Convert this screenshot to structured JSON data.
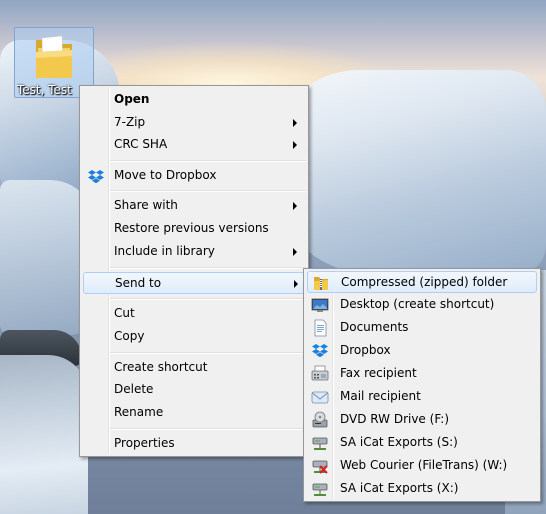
{
  "desktop_icon": {
    "label": "Test, Test",
    "icon": "folder-icon"
  },
  "context_menu": {
    "items": [
      {
        "id": "open",
        "label": "Open",
        "bold": true
      },
      {
        "id": "7zip",
        "label": "7-Zip",
        "submenu": true
      },
      {
        "id": "crc-sha",
        "label": "CRC SHA",
        "submenu": true
      },
      {
        "id": "move-to-dropbox",
        "label": "Move to Dropbox",
        "icon": "dropbox-icon"
      },
      {
        "id": "share-with",
        "label": "Share with",
        "submenu": true
      },
      {
        "id": "restore-previous-versions",
        "label": "Restore previous versions"
      },
      {
        "id": "include-in-library",
        "label": "Include in library",
        "submenu": true
      },
      {
        "id": "send-to",
        "label": "Send to",
        "submenu": true,
        "highlighted": true
      },
      {
        "id": "cut",
        "label": "Cut"
      },
      {
        "id": "copy",
        "label": "Copy"
      },
      {
        "id": "create-shortcut",
        "label": "Create shortcut"
      },
      {
        "id": "delete",
        "label": "Delete"
      },
      {
        "id": "rename",
        "label": "Rename"
      },
      {
        "id": "properties",
        "label": "Properties"
      }
    ]
  },
  "send_to_menu": {
    "items": [
      {
        "label": "Compressed (zipped) folder",
        "icon": "zip-folder-icon",
        "highlighted": true
      },
      {
        "label": "Desktop (create shortcut)",
        "icon": "desktop-icon"
      },
      {
        "label": "Documents",
        "icon": "documents-icon"
      },
      {
        "label": "Dropbox",
        "icon": "dropbox-icon"
      },
      {
        "label": "Fax recipient",
        "icon": "fax-icon"
      },
      {
        "label": "Mail recipient",
        "icon": "mail-icon"
      },
      {
        "label": "DVD RW Drive (F:)",
        "icon": "dvd-drive-icon"
      },
      {
        "label": "SA iCat Exports (S:)",
        "icon": "network-drive-icon"
      },
      {
        "label": "Web Courier (FileTrans) (W:)",
        "icon": "disconnected-network-drive-icon"
      },
      {
        "label": "SA iCat Exports (X:)",
        "icon": "network-drive-icon"
      }
    ]
  },
  "colors": {
    "menu_bg": "#f0f0f0",
    "highlight_border": "#aecff7",
    "dropbox_blue": "#1e7fd8"
  }
}
